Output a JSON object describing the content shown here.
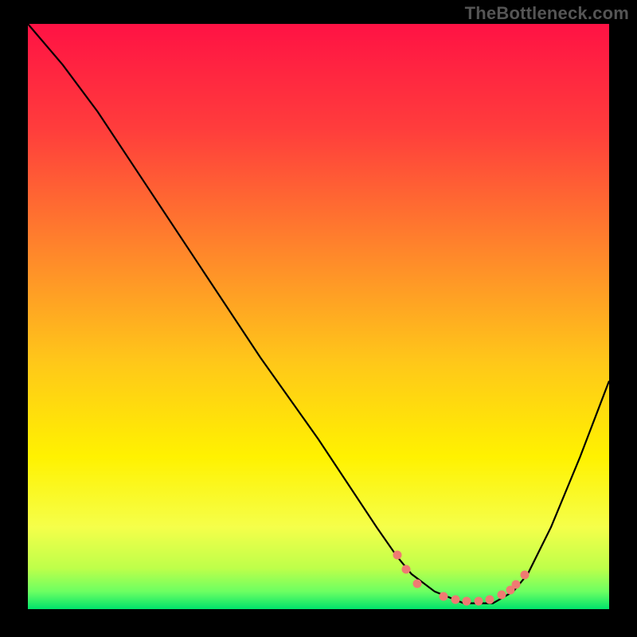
{
  "watermark": "TheBottleneck.com",
  "chart_data": {
    "type": "line",
    "title": "",
    "xlabel": "",
    "ylabel": "",
    "xlim": [
      0,
      100
    ],
    "ylim": [
      0,
      100
    ],
    "gradient_stops": [
      {
        "offset": 0,
        "color": "#ff1244"
      },
      {
        "offset": 18,
        "color": "#ff3d3c"
      },
      {
        "offset": 40,
        "color": "#ff8a2a"
      },
      {
        "offset": 58,
        "color": "#ffc819"
      },
      {
        "offset": 74,
        "color": "#fff200"
      },
      {
        "offset": 86,
        "color": "#f5ff4a"
      },
      {
        "offset": 93,
        "color": "#beff4a"
      },
      {
        "offset": 97,
        "color": "#6cff62"
      },
      {
        "offset": 100,
        "color": "#00e36b"
      }
    ],
    "series": [
      {
        "name": "bottleneck-curve",
        "color": "#000000",
        "stroke_width": 2.2,
        "x": [
          0,
          6,
          12,
          20,
          30,
          40,
          50,
          56,
          60,
          63.5,
          66,
          70,
          75,
          80,
          83.5,
          86,
          90,
          95,
          100
        ],
        "y_from_top": [
          0,
          7,
          15,
          27,
          42,
          57,
          71,
          80,
          86,
          91,
          94,
          97,
          99,
          99,
          97,
          94,
          86,
          74,
          61
        ]
      }
    ],
    "markers": {
      "name": "optimal-range-dots",
      "color": "#ef7a72",
      "radius": 5.5,
      "points": [
        {
          "x": 63.5,
          "y_from_top": 90.8
        },
        {
          "x": 65.0,
          "y_from_top": 93.2
        },
        {
          "x": 67.0,
          "y_from_top": 95.7
        },
        {
          "x": 71.5,
          "y_from_top": 97.8
        },
        {
          "x": 73.5,
          "y_from_top": 98.4
        },
        {
          "x": 75.5,
          "y_from_top": 98.7
        },
        {
          "x": 77.5,
          "y_from_top": 98.7
        },
        {
          "x": 79.5,
          "y_from_top": 98.4
        },
        {
          "x": 81.5,
          "y_from_top": 97.6
        },
        {
          "x": 83.0,
          "y_from_top": 96.7
        },
        {
          "x": 84.0,
          "y_from_top": 95.8
        },
        {
          "x": 85.5,
          "y_from_top": 94.2
        }
      ]
    }
  }
}
